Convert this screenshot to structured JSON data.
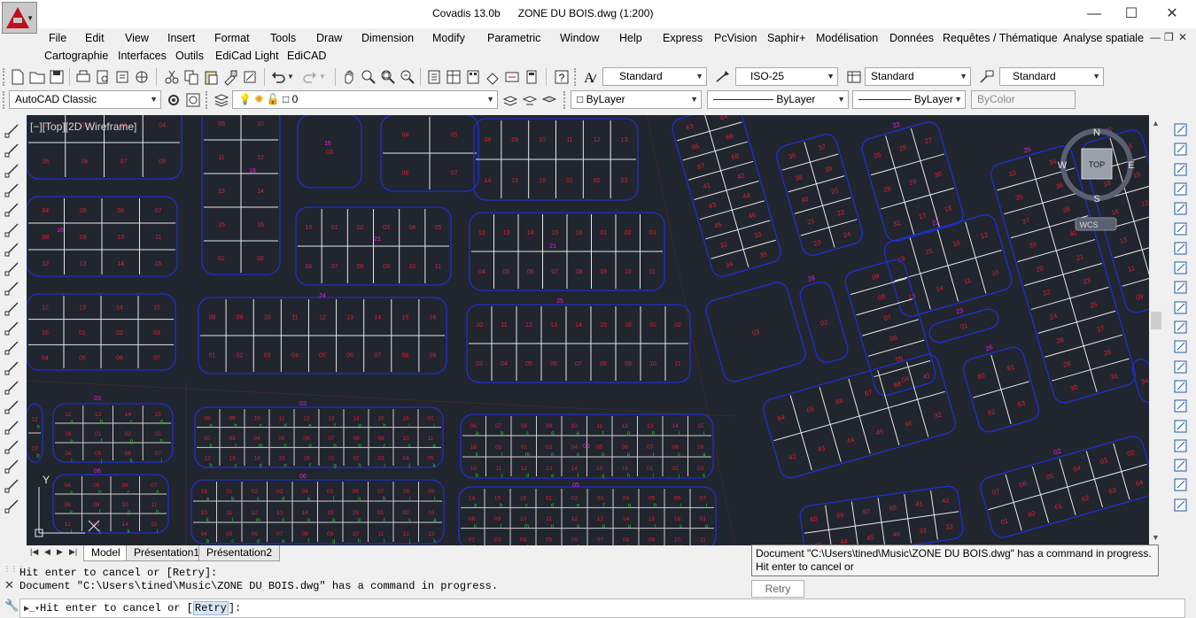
{
  "window": {
    "app_name": "Covadis 13.0b",
    "document": "ZONE DU BOIS.dwg (1:200)",
    "minimize": "—",
    "maximize": "☐",
    "close": "✕"
  },
  "menu": {
    "row1": [
      "File",
      "Edit",
      "View",
      "Insert",
      "Format",
      "Tools",
      "Draw",
      "Dimension",
      "Modify",
      "Parametric",
      "Window",
      "Help",
      "Express",
      "PcVision",
      "Saphir+",
      "Modélisation",
      "Données",
      "Requêtes / Thématique",
      "Analyse spatiale"
    ],
    "row2": [
      "Cartographie",
      "Interfaces",
      "Outils",
      "EdiCad Light",
      "EdiCAD"
    ]
  },
  "toolbar": {
    "text_style": "Standard",
    "dim_style": "ISO-25",
    "table_style": "Standard",
    "multileader_style": "Standard",
    "workspace": "AutoCAD Classic",
    "layer": "0",
    "color": "ByLayer",
    "linetype": "ByLayer",
    "lineweight": "ByLayer",
    "plotstyle": "ByColor"
  },
  "viewport": {
    "label": "[−][Top][2D Wireframe]",
    "viewcube_top": "TOP",
    "compass": {
      "n": "N",
      "s": "S",
      "e": "E",
      "w": "W"
    },
    "wcs": "WCS",
    "ucs_y": "Y",
    "colors": {
      "background": "#21252d",
      "block_outline": "#1f2fd0",
      "lot_line": "#e8e8e8",
      "lot_number": "#e02030",
      "block_label": "#e020e0",
      "green_label": "#30c030"
    }
  },
  "parcels": {
    "block_labels": [
      "16",
      "21",
      "24",
      "25",
      "26",
      "22",
      "23",
      "03",
      "06",
      "05",
      "02",
      "01",
      "04",
      "07",
      "10"
    ],
    "lot_numbers_top": [
      "01",
      "02",
      "03",
      "04",
      "05",
      "06",
      "07",
      "08",
      "09",
      "10",
      "11",
      "12",
      "13",
      "14",
      "15",
      "16"
    ],
    "lot_numbers_mid": [
      "01",
      "02",
      "03",
      "04",
      "05",
      "06",
      "07",
      "08",
      "09",
      "10",
      "11",
      "12",
      "13",
      "14",
      "15"
    ],
    "small_labels": [
      "a",
      "b",
      "c",
      "d",
      "e",
      "f",
      "g",
      "h",
      "i",
      "j",
      "k",
      "l",
      "m",
      "n",
      "o",
      "p",
      "q",
      "r",
      "s"
    ],
    "right_lots": [
      "41",
      "42",
      "43",
      "44",
      "45",
      "46",
      "32",
      "33",
      "34",
      "35",
      "36",
      "37",
      "38",
      "39",
      "40",
      "20",
      "21",
      "22",
      "23",
      "24",
      "25",
      "26",
      "27",
      "28",
      "29",
      "30",
      "31",
      "17",
      "18",
      "19",
      "15",
      "16",
      "12",
      "13",
      "14",
      "11",
      "10",
      "09",
      "08",
      "07",
      "06",
      "05",
      "04",
      "03",
      "02",
      "01",
      "60",
      "61",
      "62",
      "63",
      "64",
      "65",
      "66",
      "67",
      "68"
    ]
  },
  "tabs": {
    "model": "Model",
    "layout1": "Présentation1",
    "layout2": "Présentation2"
  },
  "command": {
    "history_line1": "Hit enter to cancel or [Retry]:",
    "history_line2": "Document \"C:\\Users\\tined\\Music\\ZONE DU BOIS.dwg\" has a command in progress.",
    "prompt_prefix": "Hit enter to cancel or [",
    "prompt_option": "Retry",
    "prompt_suffix": "]:"
  },
  "tooltip": {
    "line1": "Document \"C:\\Users\\tined\\Music\\ZONE DU BOIS.dwg\" has a command in progress.",
    "line2": "Hit enter to cancel or",
    "retry_button": "Retry"
  }
}
